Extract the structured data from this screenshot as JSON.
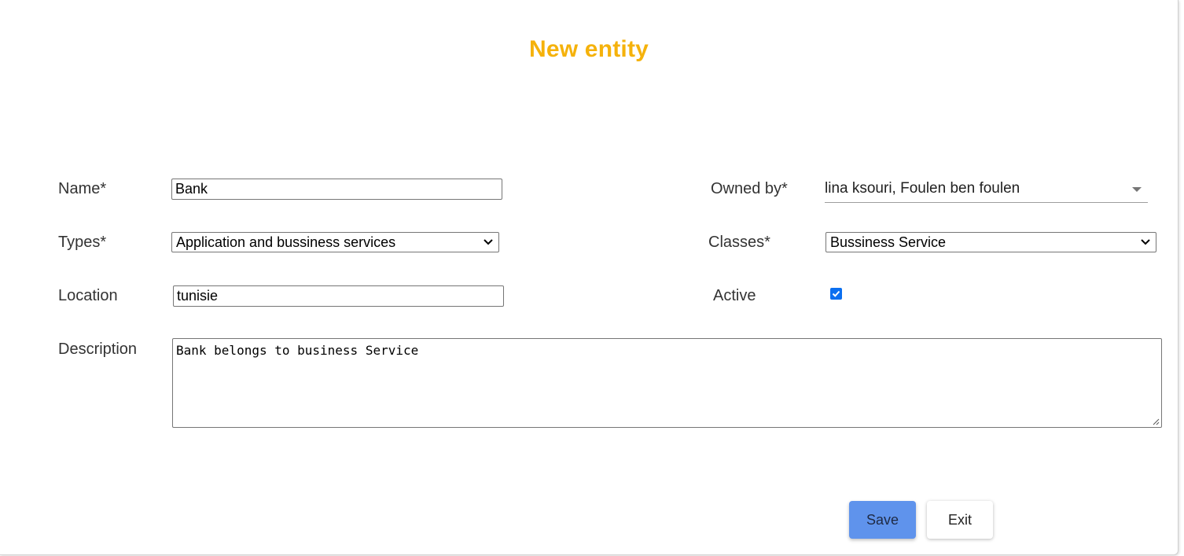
{
  "dialog": {
    "title": "New entity"
  },
  "form": {
    "name": {
      "label": "Name*",
      "value": "Bank"
    },
    "types": {
      "label": "Types*",
      "selected": "Application and bussiness services"
    },
    "location": {
      "label": "Location",
      "value": "tunisie"
    },
    "description": {
      "label": "Description",
      "value": "Bank belongs to business Service"
    },
    "owned_by": {
      "label": "Owned by*",
      "selected": "lina ksouri, Foulen ben foulen"
    },
    "classes": {
      "label": "Classes*",
      "selected": "Bussiness Service"
    },
    "active": {
      "label": "Active",
      "checked": true
    }
  },
  "actions": {
    "save_label": "Save",
    "exit_label": "Exit"
  },
  "colors": {
    "title": "#f5b20b",
    "save_button": "#5f93ec",
    "checkbox": "#0b6ff0"
  },
  "icons": {
    "select_chevron": "chevron-down-icon",
    "owned_by_arrow": "dropdown-arrow-icon",
    "checkbox_mark": "checkmark-icon",
    "resize_grip": "resize-grip-icon"
  }
}
